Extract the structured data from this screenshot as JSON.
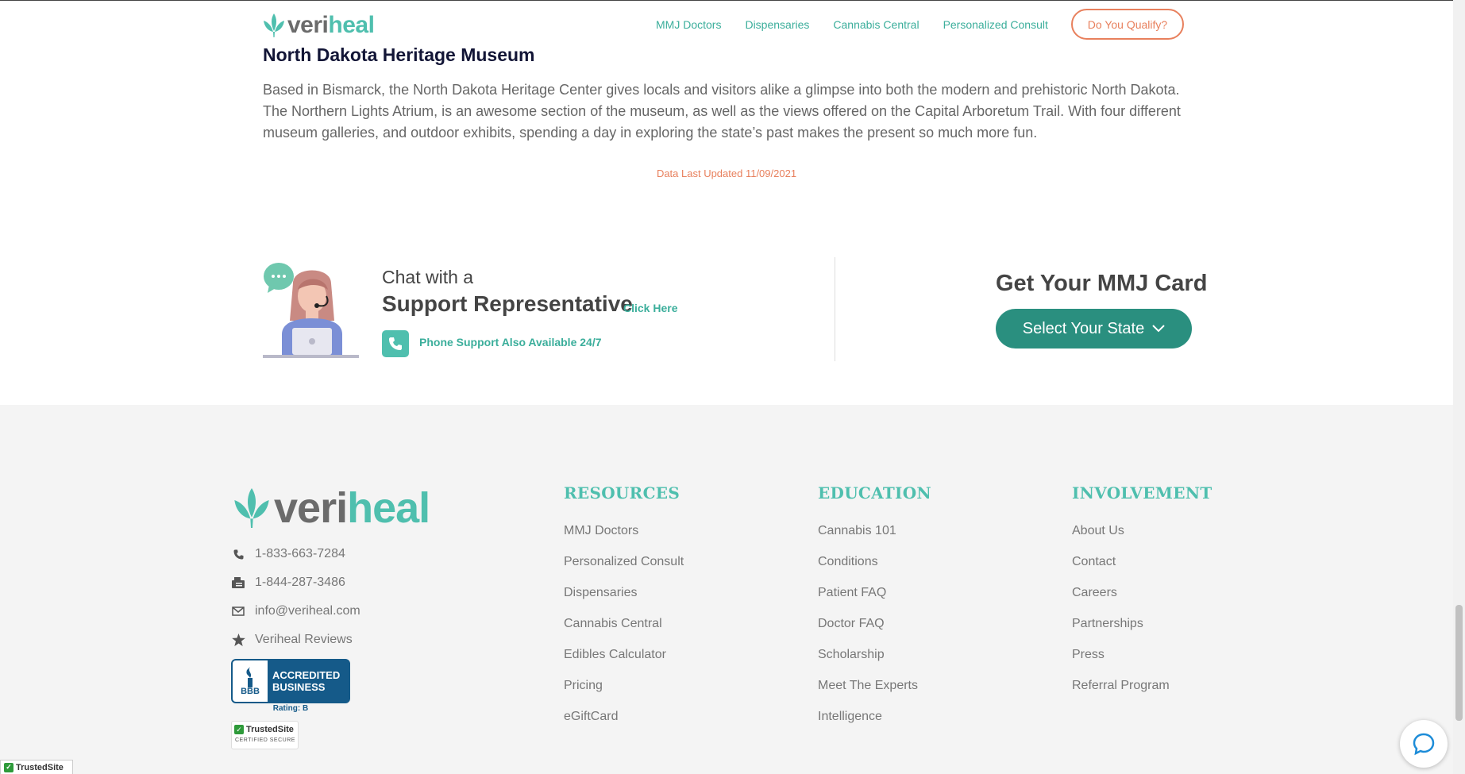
{
  "header": {
    "logo": {
      "part1": "veri",
      "part2": "heal"
    },
    "nav": [
      {
        "label": "MMJ Doctors"
      },
      {
        "label": "Dispensaries"
      },
      {
        "label": "Cannabis Central"
      },
      {
        "label": "Personalized Consult"
      }
    ],
    "qualify_button": "Do You Qualify?"
  },
  "content": {
    "heading": "North Dakota Heritage Museum",
    "paragraph": "Based in Bismarck, the North Dakota Heritage Center gives locals and visitors alike a glimpse into both the modern and prehistoric North Dakota. The Northern Lights Atrium, is an awesome section of the museum, as well as the views offered on the Capital Arboretum Trail. With four different museum galleries, and outdoor exhibits, spending a day in exploring the state’s past makes the present so much more fun.",
    "updated": "Data Last Updated 11/09/2021"
  },
  "support": {
    "line1": "Chat with a",
    "line2": "Support Representative",
    "click_here": "Click Here",
    "phone_text": "Phone Support Also Available 24/7",
    "mmj_title": "Get Your MMJ Card",
    "state_button": "Select Your State"
  },
  "footer": {
    "logo": {
      "part1": "veri",
      "part2": "heal"
    },
    "contacts": [
      {
        "icon": "phone-icon",
        "text": "1-833-663-7284"
      },
      {
        "icon": "fax-icon",
        "text": "1-844-287-3486"
      },
      {
        "icon": "envelope-icon",
        "text": "info@veriheal.com"
      },
      {
        "icon": "star-icon",
        "text": "Veriheal Reviews"
      }
    ],
    "bbb": {
      "line1": "ACCREDITED",
      "line2": "BUSINESS",
      "logo": "BBB",
      "rating": "Rating: B"
    },
    "trusted": {
      "name": "TrustedSite",
      "sub": "CERTIFIED SECURE"
    },
    "columns": [
      {
        "title": "RESOURCES",
        "items": [
          "MMJ Doctors",
          "Personalized Consult",
          "Dispensaries",
          "Cannabis Central",
          "Edibles Calculator",
          "Pricing",
          "eGiftCard"
        ]
      },
      {
        "title": "EDUCATION",
        "items": [
          "Cannabis 101",
          "Conditions",
          "Patient FAQ",
          "Doctor FAQ",
          "Scholarship",
          "Meet The Experts",
          "Intelligence"
        ]
      },
      {
        "title": "INVOLVEMENT",
        "items": [
          "About Us",
          "Contact",
          "Careers",
          "Partnerships",
          "Press",
          "Referral Program"
        ]
      }
    ]
  },
  "trusted_corner": "TrustedSite",
  "colors": {
    "teal": "#4fbfae",
    "teal_dark": "#2a8f7f",
    "orange": "#e8805d",
    "bbb_blue": "#155a89"
  }
}
